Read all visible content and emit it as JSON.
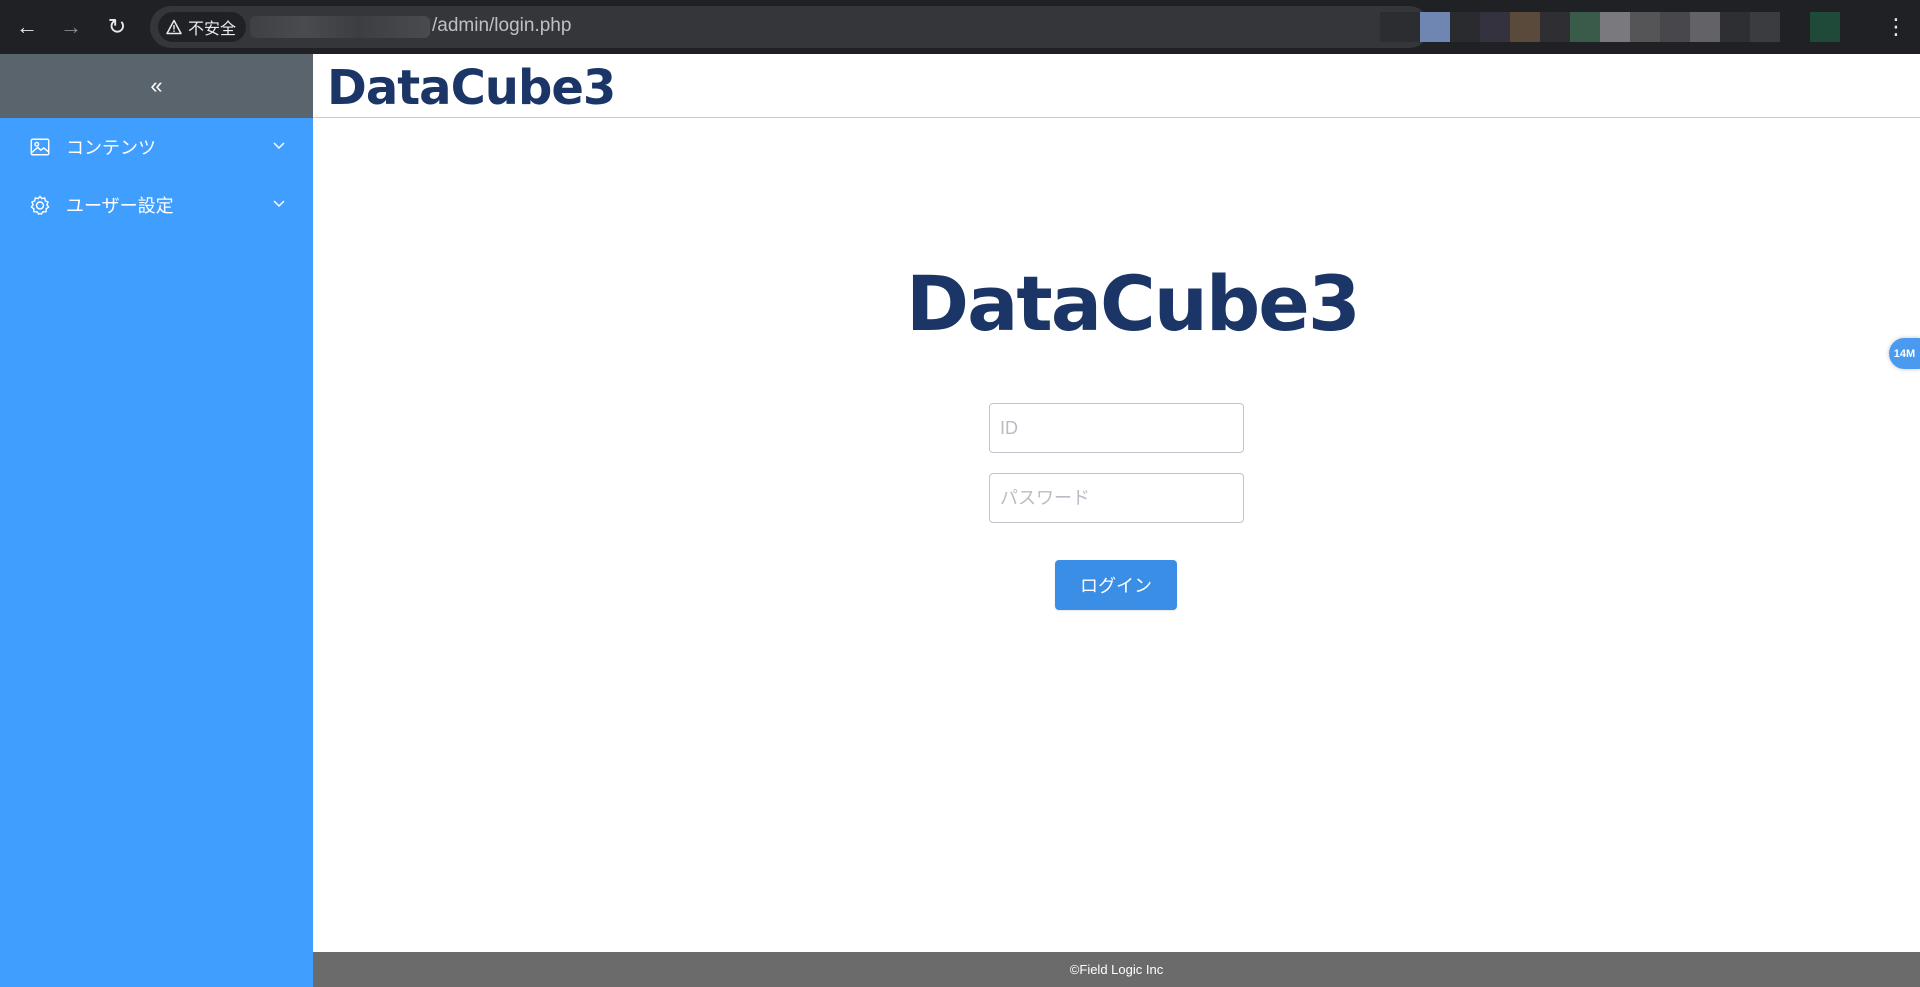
{
  "browser": {
    "security_label": "不安全",
    "url_path": "/admin/login.php"
  },
  "sidebar": {
    "collapse_glyph": "«",
    "items": [
      {
        "label": "コンテンツ",
        "icon": "image-icon"
      },
      {
        "label": "ユーザー設定",
        "icon": "gear-icon"
      }
    ]
  },
  "header": {
    "logo_text": "DataCube3"
  },
  "login": {
    "logo_text": "DataCube3",
    "id_placeholder": "ID",
    "password_placeholder": "パスワード",
    "submit_label": "ログイン"
  },
  "footer": {
    "copyright": "©Field Logic Inc"
  },
  "floating_badge": {
    "label": "14M"
  },
  "colors": {
    "sidebar_bg": "#409eff",
    "sidebar_top_bg": "#5a646c",
    "brand_navy": "#1a3566",
    "button_bg": "#3a8ee6",
    "footer_bg": "#6b6b6b"
  }
}
